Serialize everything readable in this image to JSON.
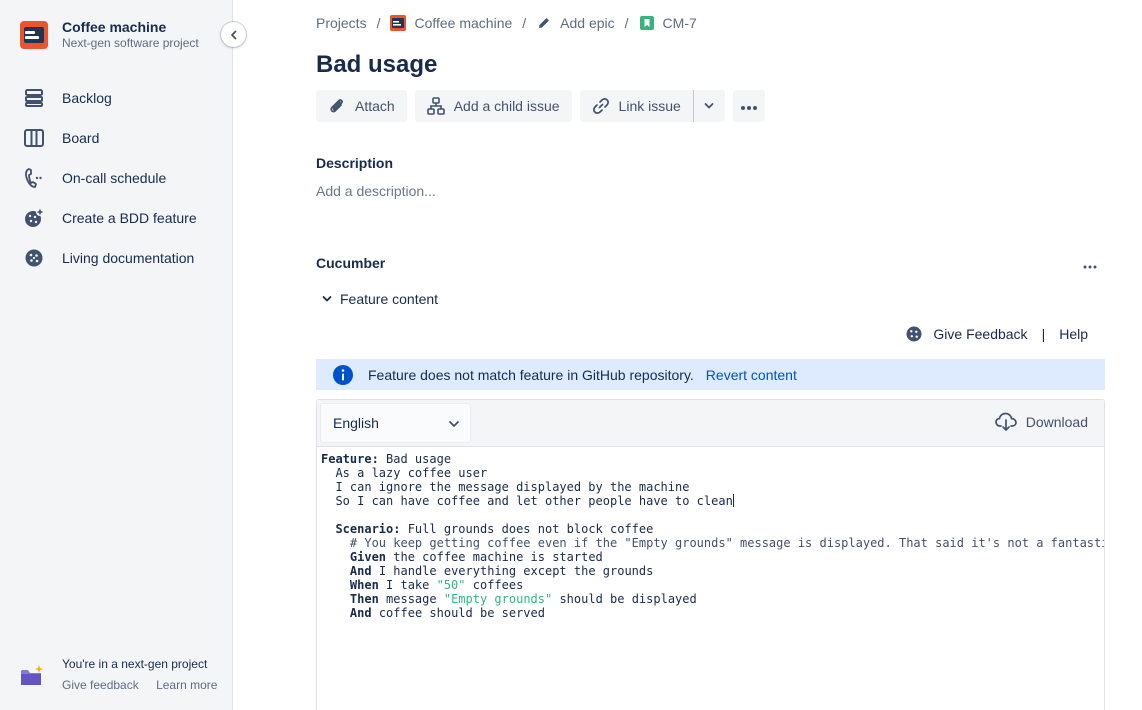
{
  "sidebar": {
    "project_name": "Coffee machine",
    "project_type": "Next-gen software project",
    "items": [
      {
        "label": "Backlog",
        "icon": "backlog-icon"
      },
      {
        "label": "Board",
        "icon": "board-icon"
      },
      {
        "label": "On-call schedule",
        "icon": "phone-icon"
      },
      {
        "label": "Create a BDD feature",
        "icon": "cucumber-add-icon"
      },
      {
        "label": "Living documentation",
        "icon": "cucumber-icon"
      }
    ],
    "footer": {
      "title": "You're in a next-gen project",
      "give_feedback": "Give feedback",
      "learn_more": "Learn more"
    }
  },
  "breadcrumb": {
    "projects": "Projects",
    "project": "Coffee machine",
    "epic": "Add epic",
    "issue_key": "CM-7"
  },
  "issue": {
    "title": "Bad usage"
  },
  "toolbar": {
    "attach": "Attach",
    "add_child": "Add a child issue",
    "link_issue": "Link issue"
  },
  "description": {
    "label": "Description",
    "placeholder": "Add a description..."
  },
  "cucumber": {
    "label": "Cucumber",
    "feature_content": "Feature content",
    "give_feedback": "Give Feedback",
    "separator": "|",
    "help": "Help",
    "banner_text": "Feature does not match feature in GitHub repository.",
    "revert": "Revert content",
    "language": "English",
    "download": "Download"
  },
  "code": {
    "feature_kw": "Feature:",
    "feature_name": " Bad usage",
    "line2": "  As a lazy coffee user",
    "line3": "  I can ignore the message displayed by the machine",
    "line4": "  So I can have coffee and let other people have to clean",
    "scenario_kw": "Scenario:",
    "scenario_name": " Full grounds does not block coffee",
    "comment": "    # You keep getting coffee even if the \"Empty grounds\" message is displayed. That said it's not a fantastic idea, you'll get a mess everywhere!",
    "given_kw": "Given",
    "given_text": " the coffee machine is started",
    "and1_kw": "And",
    "and1_text": " I handle everything except the grounds",
    "when_kw": "When",
    "when_pre": " I take ",
    "when_str": "\"50\"",
    "when_post": " coffees",
    "then_kw": "Then",
    "then_pre": " message ",
    "then_str": "\"Empty grounds\"",
    "then_post": " should be displayed",
    "and2_kw": "And",
    "and2_text": " coffee should be served"
  },
  "colors": {
    "accent": "#0052cc",
    "banner_bg": "#deebff",
    "string": "#36b37e",
    "project_icon": "#e9552c"
  }
}
